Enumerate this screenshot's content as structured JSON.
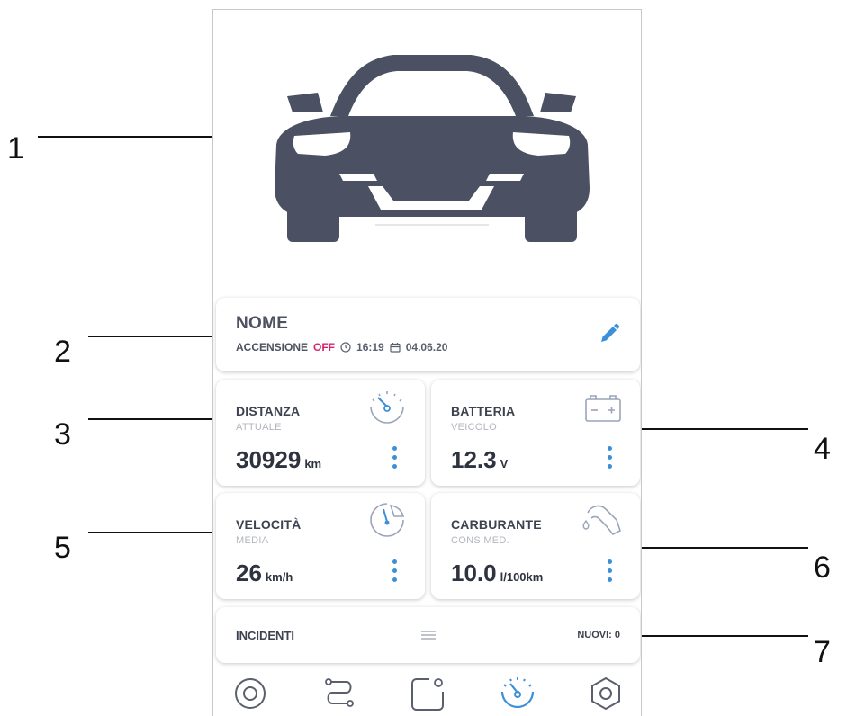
{
  "card": {
    "name": "NOME",
    "ignition_label": "ACCENSIONE",
    "ignition_state": "OFF",
    "time": "16:19",
    "date": "04.06.20"
  },
  "tiles": {
    "distance": {
      "title": "DISTANZA",
      "subtitle": "ATTUALE",
      "value": "30929",
      "unit": "km"
    },
    "battery": {
      "title": "BATTERIA",
      "subtitle": "VEICOLO",
      "value": "12.3",
      "unit": "V"
    },
    "speed": {
      "title": "VELOCITÀ",
      "subtitle": "MEDIA",
      "value": "26",
      "unit": "km/h"
    },
    "fuel": {
      "title": "CARBURANTE",
      "subtitle": "CONS.MED.",
      "value": "10.0",
      "unit": "l/100km"
    }
  },
  "incidents": {
    "title": "INCIDENTI",
    "new_label": "NUOVI: 0"
  },
  "bottom_nav": [
    "target-icon",
    "route-icon",
    "device-icon",
    "speedometer-icon",
    "settings-icon"
  ],
  "callouts": [
    "1",
    "2",
    "3",
    "4",
    "5",
    "6",
    "7"
  ],
  "colors": {
    "accent": "#3c90d8",
    "off": "#d6246e",
    "car": "#4b5062",
    "text": "#3e4250"
  }
}
